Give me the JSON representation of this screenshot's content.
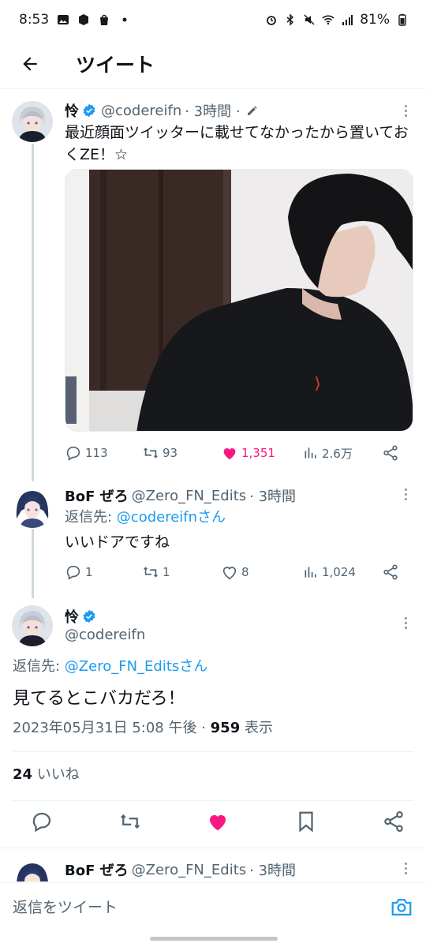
{
  "status": {
    "time": "8:53",
    "battery": "81%"
  },
  "header": {
    "title": "ツイート"
  },
  "tweet1": {
    "name": "怜",
    "handle": "@codereifn",
    "time": "· 3時間 ·",
    "text": "最近顔面ツイッターに載せてなかったから置いておくZE！☆",
    "replies": "113",
    "retweets": "93",
    "likes": "1,351",
    "views": "2.6万",
    "like_color": "#f91880"
  },
  "reply1": {
    "name": "BoF ぜろ",
    "handle": "@Zero_FN_Edits",
    "time": "· 3時間",
    "reply_prefix": "返信先: ",
    "reply_to": "@codereifnさん",
    "text": "いいドアですね",
    "replies": "1",
    "retweets": "1",
    "likes": "8",
    "views": "1,024"
  },
  "main": {
    "name": "怜",
    "handle": "@codereifn",
    "reply_prefix": "返信先: ",
    "reply_to": "@Zero_FN_Editsさん",
    "text": "見てるとこバカだろ！",
    "timestamp": "2023年05月31日 5:08 午後 · ",
    "views_count": "959",
    "views_label": " 表示",
    "likes_count": "24",
    "likes_label": " いいね"
  },
  "reply2": {
    "name": "BoF ぜろ",
    "handle": "@Zero_FN_Edits",
    "time": "· 3時間"
  },
  "reply_bar": {
    "placeholder": "返信をツイート"
  },
  "colors": {
    "accent": "#1d9bf0",
    "like": "#f91880",
    "secondary_text": "#536471"
  }
}
